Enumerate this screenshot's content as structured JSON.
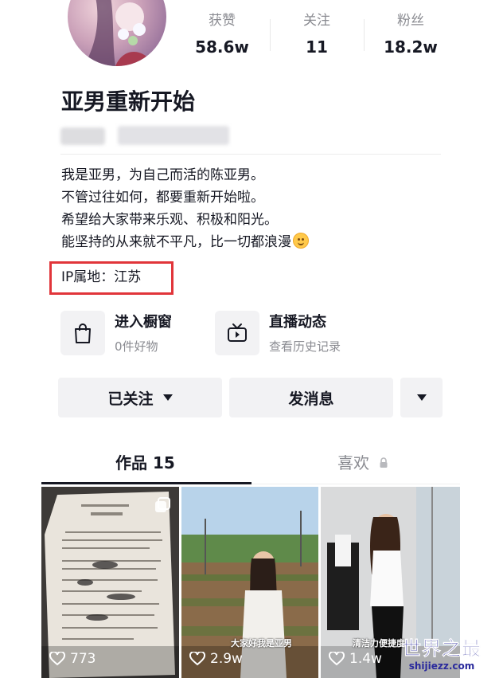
{
  "profile": {
    "name": "亚男重新开始",
    "stats": [
      {
        "label": "获赞",
        "value": "58.6w"
      },
      {
        "label": "关注",
        "value": "11"
      },
      {
        "label": "粉丝",
        "value": "18.2w"
      }
    ],
    "bio": [
      "我是亚男，为自己而活的陈亚男。",
      "不管过往如何，都要重新开始啦。",
      "希望给大家带来乐观、积极和阳光。",
      "能坚持的从来就不平凡，比一切都浪漫"
    ],
    "ip_location": "IP属地：江苏",
    "highlight_color": "#e1353a"
  },
  "features": [
    {
      "title": "进入橱窗",
      "subtitle": "0件好物",
      "icon": "shopping-bag-icon"
    },
    {
      "title": "直播动态",
      "subtitle": "查看历史记录",
      "icon": "tv-icon"
    }
  ],
  "actions": {
    "follow_label": "已关注",
    "message_label": "发消息"
  },
  "tabs": {
    "works_label": "作品 15",
    "likes_label": "喜欢"
  },
  "videos": [
    {
      "likes": "773",
      "caption": ""
    },
    {
      "likes": "2.9w",
      "caption": "大家好我是亚男"
    },
    {
      "likes": "1.4w",
      "caption": "清洁力便捷度"
    }
  ],
  "watermark": {
    "title": "世界之最",
    "domain": "shijiezz.com"
  }
}
